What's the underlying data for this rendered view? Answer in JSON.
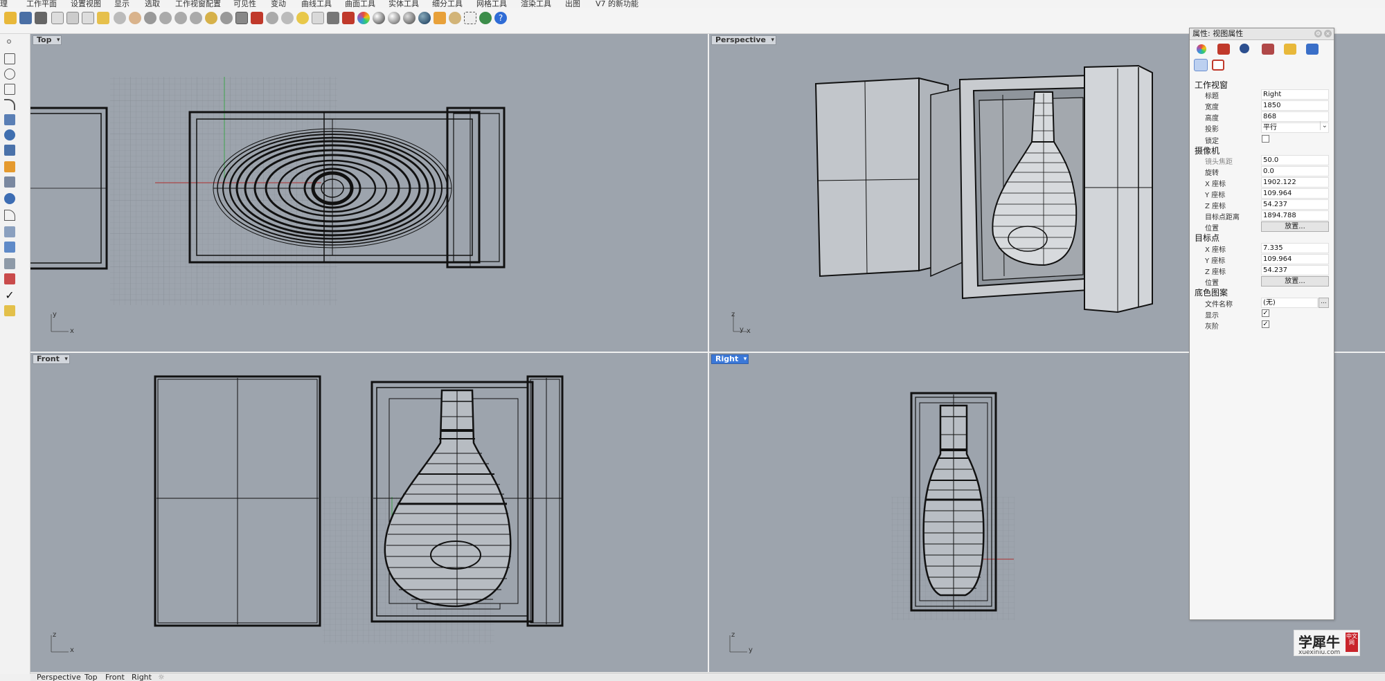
{
  "menu": [
    "工作平面",
    "设置视图",
    "显示",
    "选取",
    "工作视窗配置",
    "可见性",
    "变动",
    "曲线工具",
    "曲面工具",
    "实体工具",
    "细分工具",
    "网格工具",
    "渲染工具",
    "出图",
    "V7 的新功能"
  ],
  "menu_prefix": "理",
  "viewports": {
    "top": {
      "label": "Top"
    },
    "perspective": {
      "label": "Perspective"
    },
    "front": {
      "label": "Front"
    },
    "right": {
      "label": "Right"
    }
  },
  "axes": {
    "x": "x",
    "y": "y",
    "z": "z"
  },
  "tabs": [
    "Perspective",
    "Top",
    "Front",
    "Right"
  ],
  "tabs_add": "☼",
  "panel": {
    "title": "属性: 视图属性",
    "section_viewport": "工作视窗",
    "title_label": "标题",
    "title_value": "Right",
    "width_label": "宽度",
    "width_value": "1850",
    "height_label": "高度",
    "height_value": "868",
    "projection_label": "投影",
    "projection_value": "平行",
    "lock_label": "锁定",
    "section_camera": "摄像机",
    "focal_label": "镜头焦距",
    "focal_value": "50.0",
    "rotation_label": "旋转",
    "rotation_value": "0.0",
    "cam_x_label": "X 座标",
    "cam_x_value": "1902.122",
    "cam_y_label": "Y 座标",
    "cam_y_value": "109.964",
    "cam_z_label": "Z 座标",
    "cam_z_value": "54.237",
    "target_dist_label": "目标点距离",
    "target_dist_value": "1894.788",
    "position_label": "位置",
    "place_button": "放置...",
    "section_target": "目标点",
    "tgt_x_label": "X 座标",
    "tgt_x_value": "7.335",
    "tgt_y_label": "Y 座标",
    "tgt_y_value": "109.964",
    "tgt_z_label": "Z 座标",
    "tgt_z_value": "54.237",
    "tgt_position_label": "位置",
    "tgt_place_button": "放置...",
    "section_wallpaper": "底色图案",
    "filename_label": "文件名称",
    "filename_value": "(无)",
    "show_label": "显示",
    "show_checked": "✓",
    "gray_label": "灰阶",
    "gray_checked": "✓",
    "dots": "..."
  },
  "watermark": {
    "main": "学犀牛",
    "sub": "xuexiniu.com",
    "seal": "中文网"
  },
  "colors": {
    "viewport_bg": "#9da4ad",
    "active_label": "#3b78d8",
    "wire": "#111111"
  }
}
